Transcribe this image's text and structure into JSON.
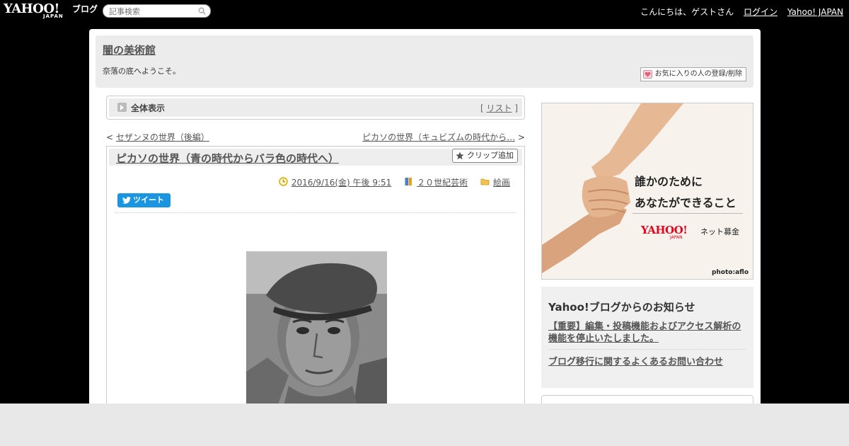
{
  "topbar": {
    "logo_text": "YAHOO!",
    "logo_sub": "JAPAN",
    "logo_service": "ブログ",
    "search_placeholder": "記事検索",
    "greeting": "こんにちは、ゲストさん",
    "login": "ログイン",
    "yahoo_japan": "Yahoo! JAPAN"
  },
  "header": {
    "blog_title": "闇の美術館",
    "description": "奈落の底へようこそ。",
    "favorite_button": "お気に入りの人の登録/削除"
  },
  "viewbar": {
    "label": "全体表示",
    "list_open": "[",
    "list_link": "リスト",
    "list_close": "]"
  },
  "navigation": {
    "prev_arrow": "<",
    "prev_link": "セザンヌの世界（後編）",
    "next_link": "ピカソの世界（キュビズムの時代から…",
    "next_arrow": ">"
  },
  "article": {
    "title": "ピカソの世界（青の時代からバラ色の時代へ）",
    "clip_button": "クリップ追加",
    "date": "2016/9/16(金) 午後 9:51",
    "category": "２０世紀芸術",
    "folder": "絵画",
    "tweet_button": "ツイート"
  },
  "ad": {
    "line1": "誰かのために",
    "line2": "あなたができること",
    "brand": "YAHOO!",
    "brand_sub": "JAPAN",
    "campaign": "ネット募金",
    "credit": "photo:aflo"
  },
  "notices": {
    "heading": "Yahoo!ブログからのお知らせ",
    "items": [
      "【重要】編集・投稿機能およびアクセス解析の機能を停止いたしました。",
      "ブログ移行に関するよくあるお問い合わせ"
    ]
  },
  "colors": {
    "topbar_bg": "#000000",
    "tweet_blue": "#1b95e0",
    "yahoo_red": "#e6001e"
  }
}
